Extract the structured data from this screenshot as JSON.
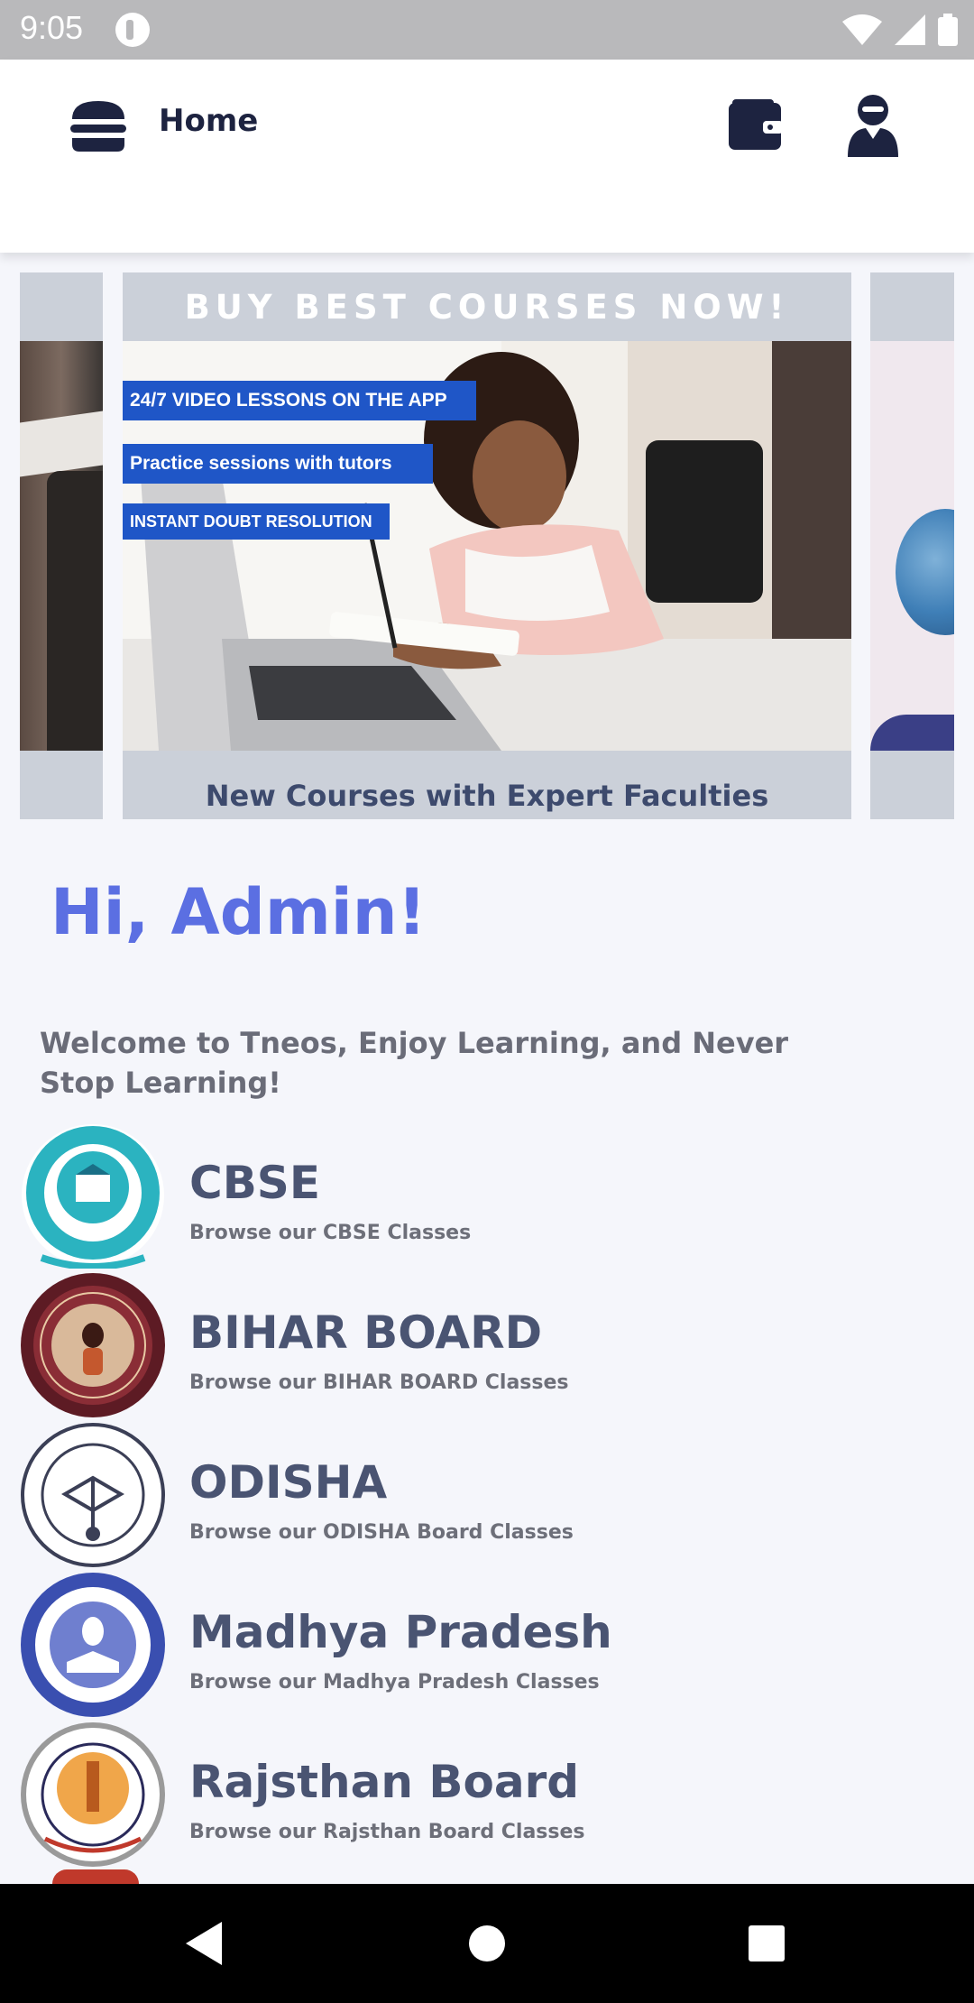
{
  "status_bar": {
    "time": "9:05"
  },
  "app_bar": {
    "title": "Home"
  },
  "banner": {
    "heading": "BUY BEST COURSES NOW!",
    "tags": [
      "24/7 VIDEO LESSONS ON THE APP",
      "Practice sessions with tutors",
      "INSTANT DOUBT RESOLUTION"
    ],
    "footer": "New Courses with Expert Faculties"
  },
  "greeting": "Hi, Admin!",
  "welcome": "Welcome to Tneos, Enjoy Learning, and Never Stop Learning!",
  "boards": [
    {
      "name": "CBSE",
      "subtitle": "Browse our CBSE Classes"
    },
    {
      "name": "BIHAR BOARD",
      "subtitle": "Browse our BIHAR BOARD Classes"
    },
    {
      "name": "ODISHA",
      "subtitle": "Browse our ODISHA Board Classes"
    },
    {
      "name": "Madhya Pradesh",
      "subtitle": "Browse our Madhya Pradesh Classes"
    },
    {
      "name": "Rajsthan Board",
      "subtitle": "Browse our Rajsthan Board Classes"
    }
  ],
  "colors": {
    "accent": "#5b6fe2",
    "dark": "#1d2340",
    "tag_blue": "#1f56c7"
  },
  "icons": [
    "menu-icon",
    "wallet-icon",
    "user-icon",
    "wifi-icon",
    "signal-icon",
    "battery-icon",
    "back-icon",
    "home-icon",
    "recents-icon"
  ]
}
